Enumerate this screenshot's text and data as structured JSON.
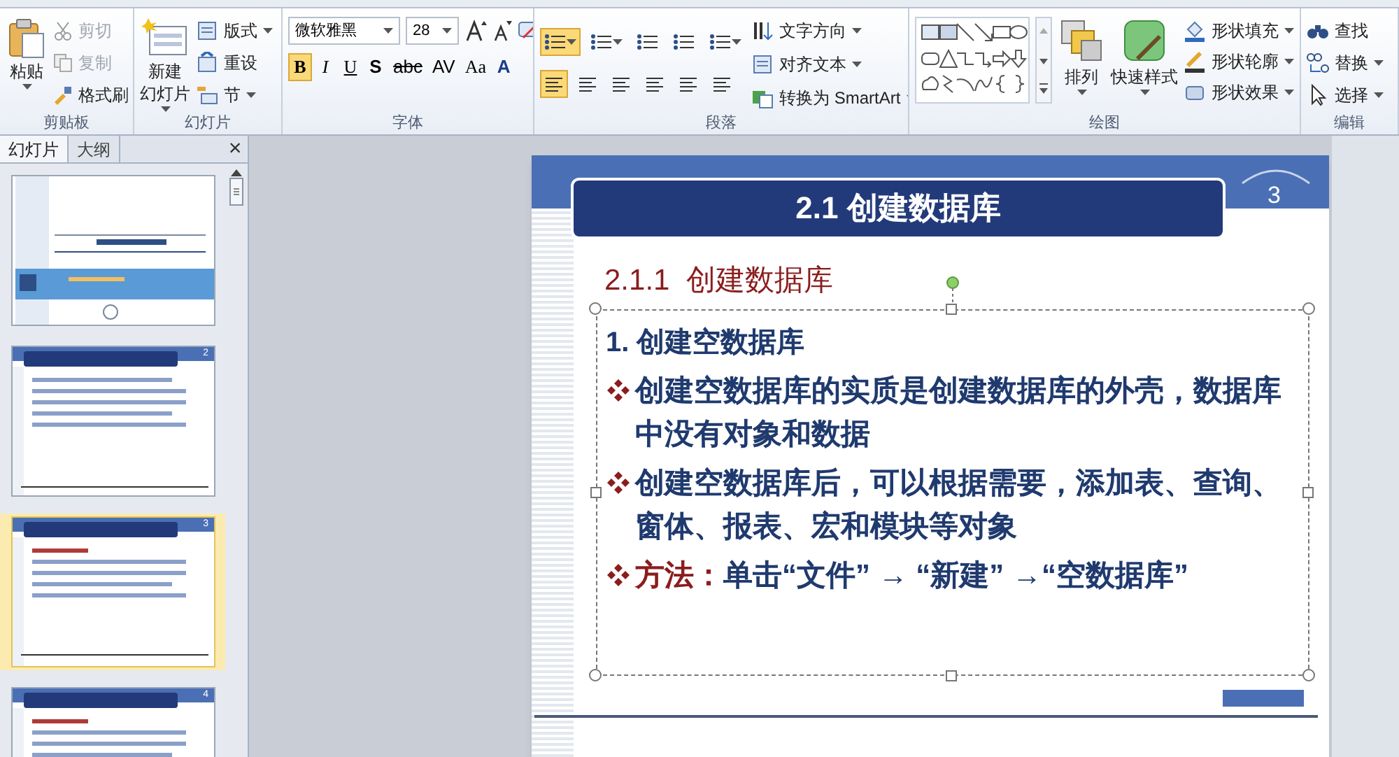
{
  "ribbon": {
    "groups": [
      {
        "label": "剪贴板",
        "items": [
          {
            "kind": "large",
            "lines": [
              "粘贴"
            ],
            "disabled": false
          },
          {
            "kind": "small",
            "label": "剪切",
            "disabled": true
          },
          {
            "kind": "small",
            "label": "复制",
            "disabled": true
          },
          {
            "kind": "small",
            "label": "格式刷",
            "disabled": false
          }
        ]
      },
      {
        "label": "幻灯片",
        "items": [
          {
            "kind": "large",
            "lines": [
              "新建",
              "幻灯片"
            ],
            "disabled": false
          },
          {
            "kind": "small",
            "label": "版式",
            "disabled": false
          },
          {
            "kind": "small",
            "label": "重设",
            "disabled": false
          },
          {
            "kind": "small",
            "label": "节",
            "disabled": false
          }
        ]
      },
      {
        "label": "字体",
        "font_name": "微软雅黑",
        "font_size": "28",
        "format": [
          {
            "label": "B",
            "selected": true
          },
          {
            "label": "I",
            "selected": false
          },
          {
            "label": "U",
            "selected": false
          },
          {
            "label": "S",
            "selected": false
          },
          {
            "label": "abc",
            "selected": false
          },
          {
            "label": "AV",
            "selected": false
          },
          {
            "label": "Aa",
            "selected": false
          },
          {
            "label": "A",
            "selected": false
          }
        ]
      },
      {
        "label": "段落",
        "tools": [
          {
            "selected": true
          },
          {
            "selected": false
          },
          {
            "selected": false
          },
          {
            "selected": false
          },
          {
            "selected": false
          }
        ],
        "align": [
          {
            "selected": true
          },
          {
            "selected": false
          },
          {
            "selected": false
          },
          {
            "selected": false
          },
          {
            "selected": false
          },
          {
            "selected": false
          }
        ],
        "items": [
          {
            "kind": "small",
            "label": "文字方向",
            "disabled": false
          },
          {
            "kind": "small",
            "label": "对齐文本",
            "disabled": false
          },
          {
            "kind": "small",
            "label": "转换为 SmartArt",
            "disabled": false
          }
        ]
      },
      {
        "label": "绘图",
        "items": [
          {
            "kind": "large",
            "lines": [
              "排列"
            ],
            "disabled": false
          },
          {
            "kind": "large",
            "lines": [
              "快速样式"
            ],
            "disabled": false
          },
          {
            "kind": "small",
            "label": "形状填充",
            "disabled": false
          },
          {
            "kind": "small",
            "label": "形状轮廓",
            "disabled": false
          },
          {
            "kind": "small",
            "label": "形状效果",
            "disabled": false
          }
        ]
      },
      {
        "label": "编辑",
        "items": [
          {
            "kind": "small",
            "label": "查找",
            "disabled": false
          },
          {
            "kind": "small",
            "label": "替换",
            "disabled": false
          },
          {
            "kind": "small",
            "label": "选择",
            "disabled": false
          }
        ]
      }
    ]
  },
  "panel": {
    "tabs": [
      {
        "label": "幻灯片",
        "selected": true
      },
      {
        "label": "大纲",
        "selected": false
      }
    ],
    "close": "×",
    "thumbnails": [
      {
        "selected": false
      },
      {
        "number": "2",
        "selected": false
      },
      {
        "number": "3",
        "selected": true
      },
      {
        "number": "4",
        "selected": false
      }
    ]
  },
  "slide": {
    "title": "2.1 创建数据库",
    "number": "3",
    "subtitle": "2.1.1  创建数据库",
    "body": [
      {
        "kind": "heading",
        "text": "1. 创建空数据库"
      },
      {
        "kind": "bullet",
        "text": "创建空数据库的实质是创建数据库的外壳，数据库中没有对象和数据"
      },
      {
        "kind": "bullet",
        "text": "创建空数据库后，可以根据需要，添加表、查询、窗体、报表、宏和模块等对象"
      },
      {
        "kind": "bullet",
        "lead": "方法：",
        "text": "单击“文件” → “新建” →“空数据库”"
      }
    ]
  }
}
